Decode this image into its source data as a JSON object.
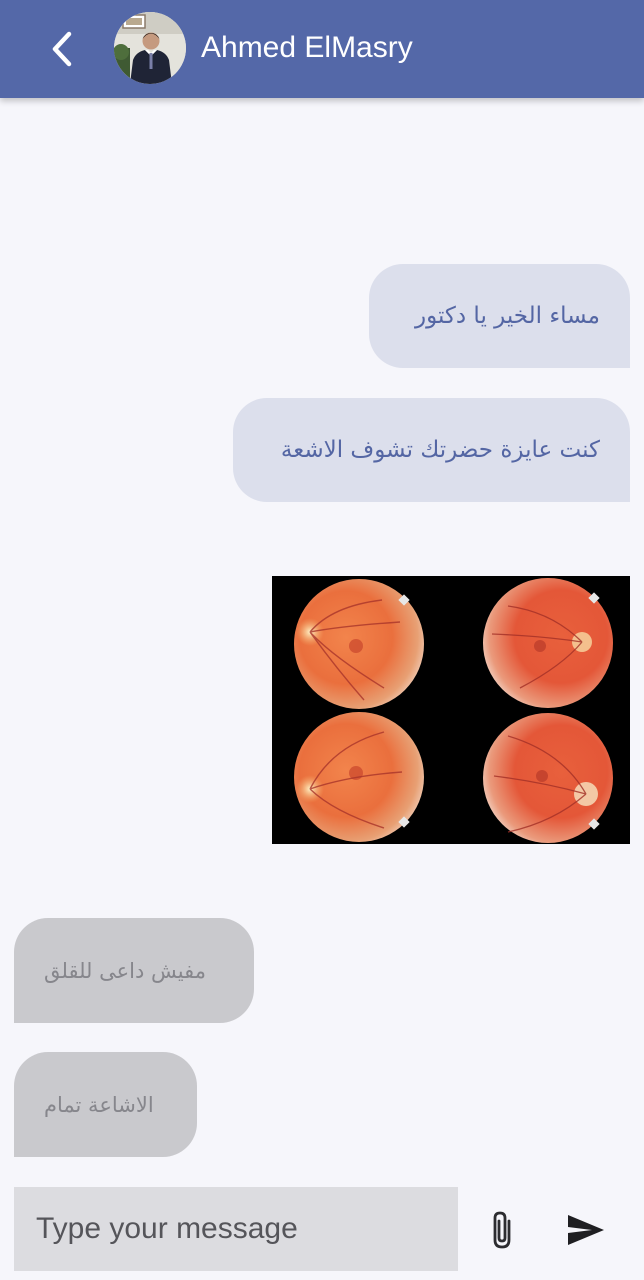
{
  "header": {
    "contact_name": "Ahmed ElMasry",
    "back_icon": "chevron-left-icon",
    "background_color": "#5468a8"
  },
  "messages": [
    {
      "direction": "outgoing",
      "text": "مساء الخير يا دكتور"
    },
    {
      "direction": "outgoing",
      "text": "كنت عايزة حضرتك تشوف الاشعة"
    },
    {
      "direction": "outgoing",
      "type": "image",
      "content": "retinal fundus photographs (4)"
    },
    {
      "direction": "incoming",
      "text": "مفيش داعى للقلق"
    },
    {
      "direction": "incoming",
      "text": "الاشاعة تمام"
    }
  ],
  "composer": {
    "placeholder": "Type your message",
    "attach_icon": "paperclip-icon",
    "send_icon": "send-icon"
  },
  "colors": {
    "outgoing_bubble": "#dcdfec",
    "outgoing_text": "#5466a4",
    "incoming_bubble": "#c9c9cd",
    "incoming_text": "#86868c",
    "background": "#f6f6fb"
  }
}
